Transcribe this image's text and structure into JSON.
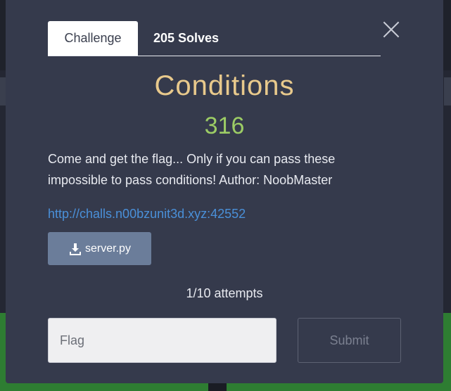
{
  "background": {
    "left_count": "100",
    "right_count": "100"
  },
  "tabs": [
    {
      "label": "Challenge",
      "active": true
    },
    {
      "label": "205 Solves",
      "active": false
    }
  ],
  "challenge": {
    "name": "Conditions",
    "points": "316",
    "description": "Come and get the flag... Only if you can pass these impossible to pass conditions! Author: NoobMaster",
    "link": "http://challs.n00bzunit3d.xyz:42552",
    "file_label": "server.py",
    "file_icon": "download-icon"
  },
  "attempts": "1/10 attempts",
  "flag_input": {
    "placeholder": "Flag",
    "value": ""
  },
  "submit_label": "Submit",
  "colors": {
    "title": "#e8c98c",
    "points": "#9ccc65",
    "link": "#4a90d9",
    "modal_bg": "#353a4c",
    "file_button": "#6b7d9a"
  }
}
